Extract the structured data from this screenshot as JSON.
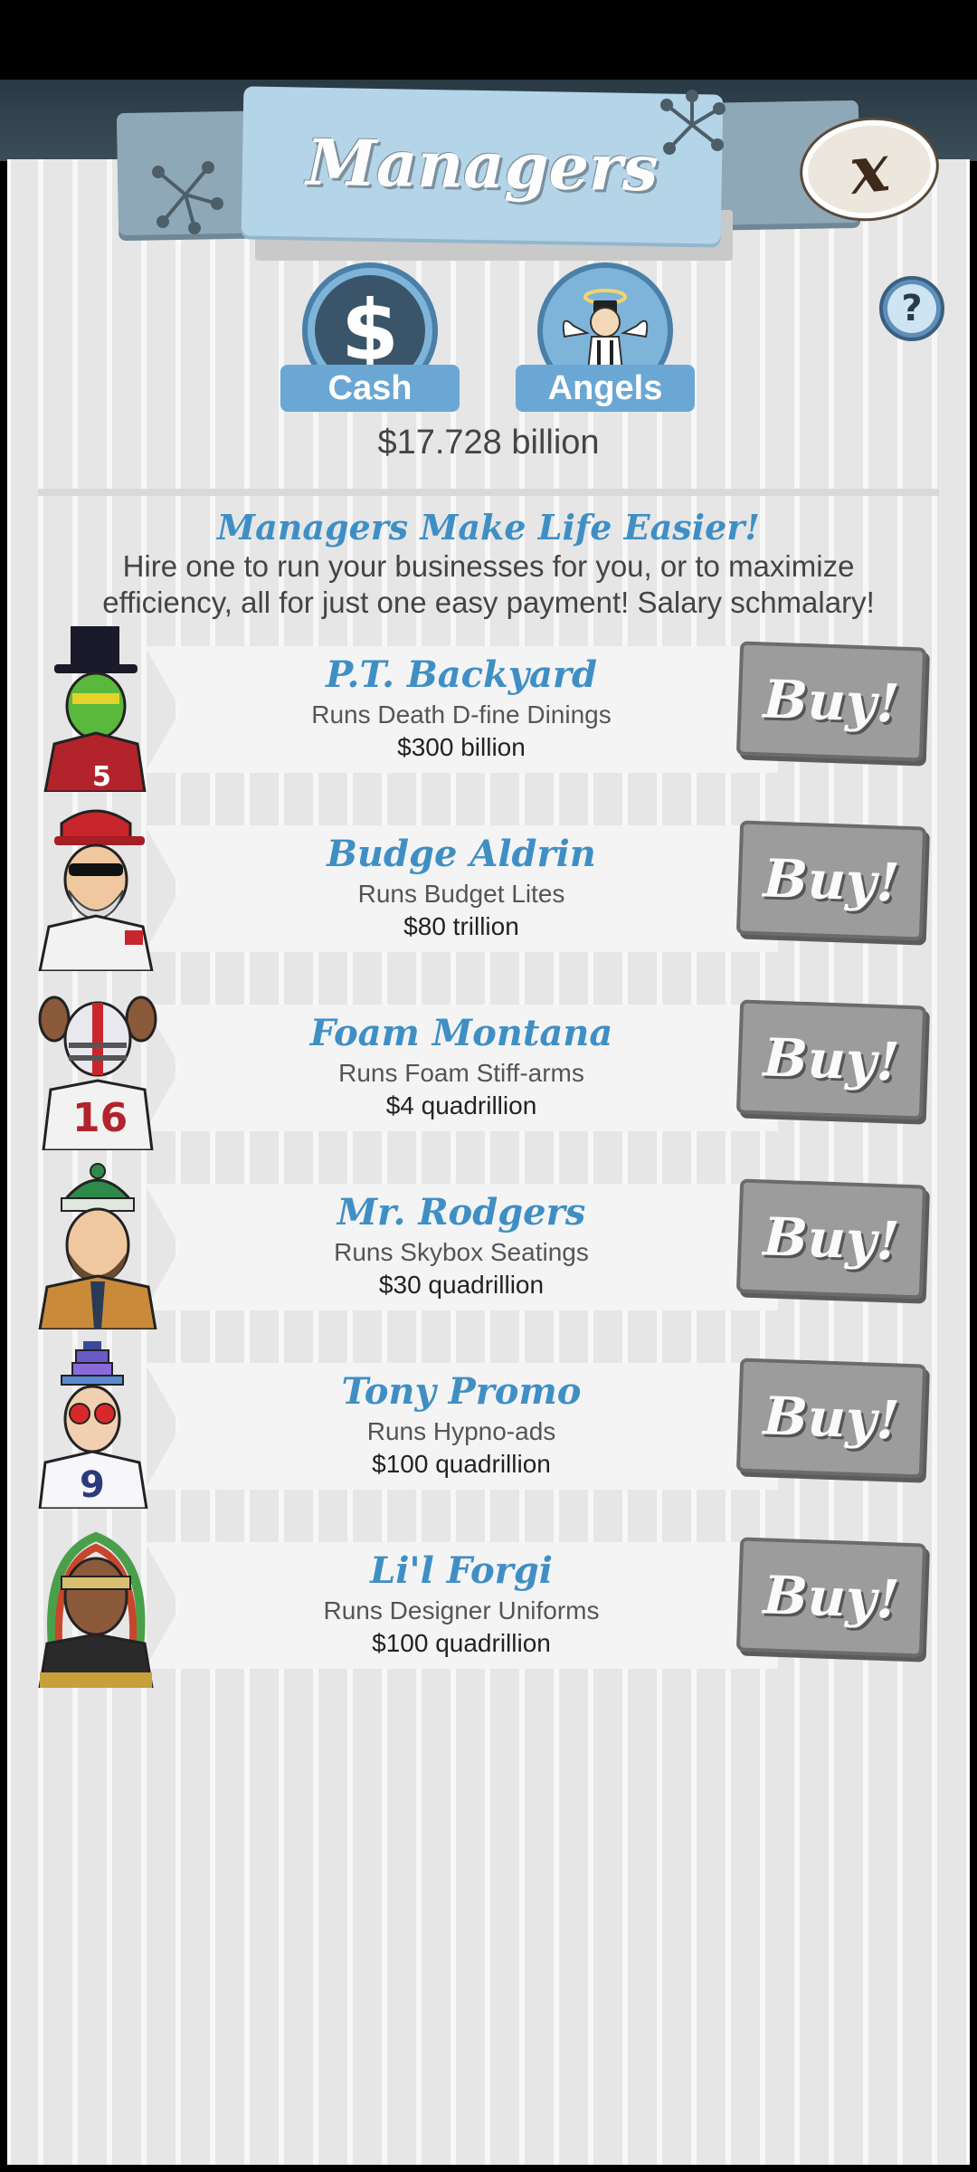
{
  "header": {
    "title": "Managers"
  },
  "tabs": [
    {
      "label": "Cash",
      "icon": "dollar-icon"
    },
    {
      "label": "Angels",
      "icon": "angel-icon"
    }
  ],
  "balance": "$17.728 billion",
  "intro": {
    "tagline": "Managers Make Life Easier!",
    "description": "Hire one to run your businesses for you, or to maximize efficiency, all for just one easy payment! Salary schmalary!"
  },
  "managers": [
    {
      "name": "P.T. Backyard",
      "runs": "Runs Death D-fine Dinings",
      "cost": "$300 billion",
      "buy_label": "Buy!"
    },
    {
      "name": "Budge Aldrin",
      "runs": "Runs Budget Lites",
      "cost": "$80 trillion",
      "buy_label": "Buy!"
    },
    {
      "name": "Foam Montana",
      "runs": "Runs Foam Stiff-arms",
      "cost": "$4 quadrillion",
      "buy_label": "Buy!"
    },
    {
      "name": "Mr. Rodgers",
      "runs": "Runs Skybox Seatings",
      "cost": "$30 quadrillion",
      "buy_label": "Buy!"
    },
    {
      "name": "Tony Promo",
      "runs": "Runs Hypno-ads",
      "cost": "$100 quadrillion",
      "buy_label": "Buy!"
    },
    {
      "name": "Li'l Forgi",
      "runs": "Runs Designer Uniforms",
      "cost": "$100 quadrillion",
      "buy_label": "Buy!"
    }
  ],
  "colors": {
    "accent": "#3f8fc5",
    "tab": "#6aa7d4",
    "button": "#9c9c9c"
  }
}
